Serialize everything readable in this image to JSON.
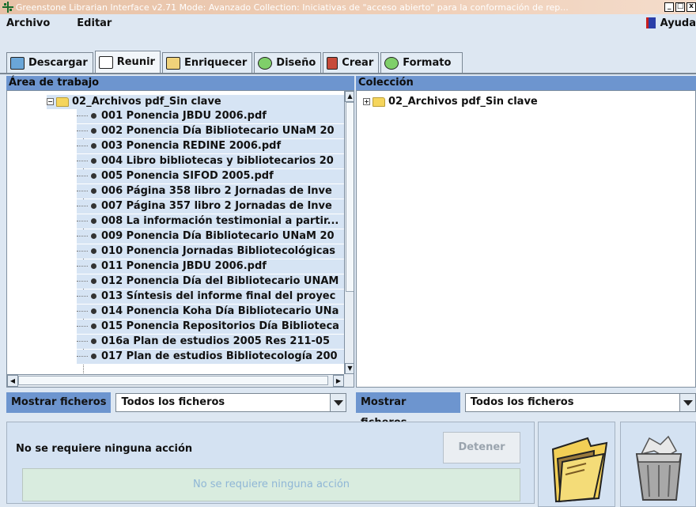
{
  "window": {
    "title": "Greenstone Librarian Interface v2.71  Mode: Avanzado  Collection: Iniciativas de \"acceso abierto\" para la conformación de rep..."
  },
  "menu": {
    "file": "Archivo",
    "edit": "Editar",
    "help": "Ayuda"
  },
  "tabs": [
    {
      "label": "Descargar"
    },
    {
      "label": "Reunir"
    },
    {
      "label": "Enriquecer"
    },
    {
      "label": "Diseño"
    },
    {
      "label": "Crear"
    },
    {
      "label": "Formato"
    }
  ],
  "workspace": {
    "header": "Área de trabajo",
    "folder": "02_Archivos pdf_Sin clave",
    "files": [
      "001 Ponencia JBDU 2006.pdf",
      "002 Ponencia Día Bibliotecario UNaM 20",
      "003 Ponencia REDINE 2006.pdf",
      "004 Libro bibliotecas y bibliotecarios 20",
      "005 Ponencia SIFOD 2005.pdf",
      "006 Página 358 libro 2 Jornadas de Inve",
      "007 Página 357 libro 2 Jornadas de Inve",
      "008 La información testimonial a partir...",
      "009 Ponencia Día Bibliotecario UNaM 20",
      "010 Ponencia Jornadas Bibliotecológicas",
      "011 Ponencia JBDU 2006.pdf",
      "012 Ponencia Día del Bibliotecario UNAM",
      "013 Síntesis del informe final del proyec",
      "014 Ponencia Koha Día Bibliotecario UNa",
      "015 Ponencia Repositorios Día Biblioteca",
      "016a Plan de estudios 2005 Res 211-05",
      "017 Plan de estudios Bibliotecología 200"
    ],
    "filter_label": "Mostrar ficheros",
    "filter_value": "Todos los ficheros"
  },
  "collection": {
    "header": "Colección",
    "folder": "02_Archivos pdf_Sin clave",
    "filter_label": "Mostrar ficheros",
    "filter_value": "Todos los ficheros"
  },
  "status": {
    "message": "No se requiere ninguna acción",
    "stop_label": "Detener",
    "progress_text": "No se requiere ninguna acción"
  },
  "icons": {
    "folder": "open-folder-icon",
    "trash": "trash-bin-icon"
  }
}
